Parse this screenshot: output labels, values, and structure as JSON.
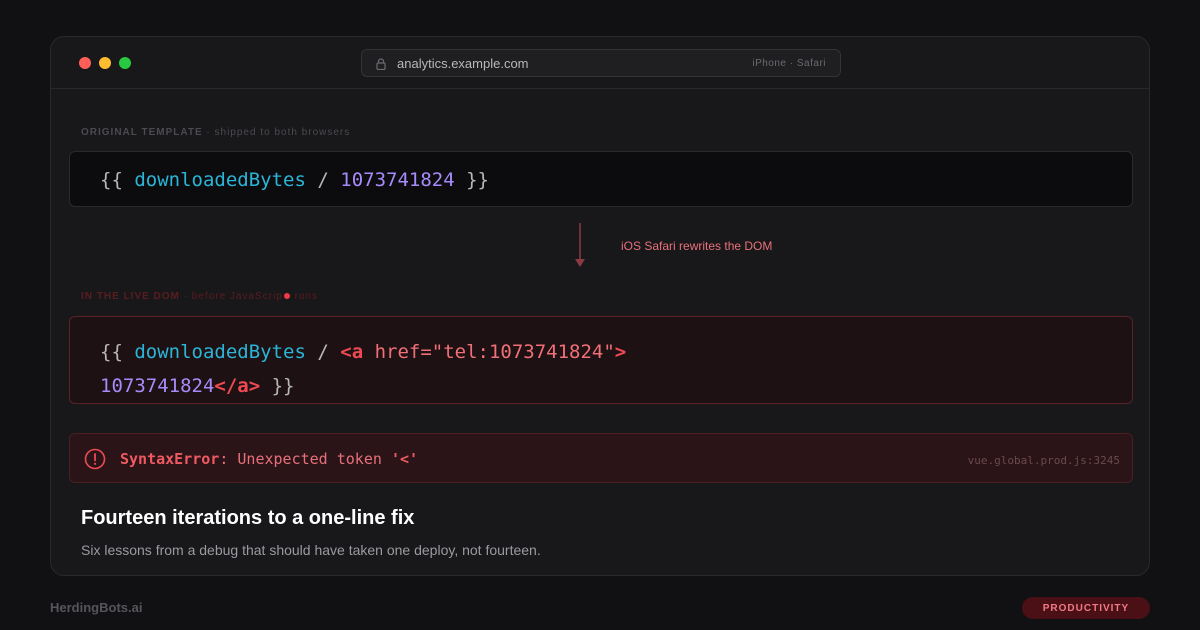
{
  "browser": {
    "url": "analytics.example.com",
    "device": "iPhone · Safari"
  },
  "original": {
    "label_strong": "ORIGINAL TEMPLATE",
    "label_rest": " · shipped to both browsers",
    "code": {
      "open": "{{ ",
      "var": "downloadedBytes",
      "op": " / ",
      "num": "1073741824",
      "close": " }}"
    }
  },
  "rewrite": {
    "label": "iOS Safari rewrites the DOM"
  },
  "live": {
    "label_strong": "IN THE LIVE DOM",
    "label_rest_a": " · before JavaScrip",
    "label_rest_b": " runs",
    "code": {
      "open": "{{ ",
      "var": "downloadedBytes",
      "op": " / ",
      "tag_open_lt": "<a ",
      "attr": "href=\"tel:1073741824\"",
      "tag_open_gt": ">",
      "num": "1073741824",
      "tag_close": "</a>",
      "close": " }}"
    }
  },
  "error": {
    "name": "SyntaxError",
    "message": ": Unexpected token ",
    "token": "'<'",
    "source": "vue.global.prod.js:3245"
  },
  "article": {
    "title": "Fourteen iterations to a one-line fix",
    "subtitle": "Six lessons from a debug that should have taken one deploy, not fourteen."
  },
  "footer": {
    "brand": "HerdingBots.ai",
    "category": "PRODUCTIVITY"
  },
  "colors": {
    "accent_red": "#ef4a54",
    "variable": "#2bb5d8",
    "number": "#a78bfa"
  }
}
